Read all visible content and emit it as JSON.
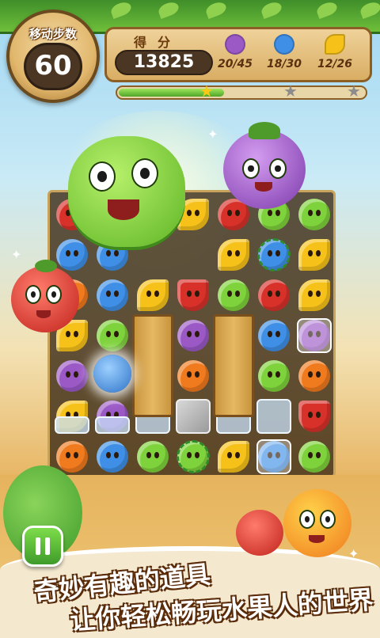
{
  "hud": {
    "moves_label": "移动步数",
    "moves_value": "60",
    "score_label": "得分",
    "score_value": "13825",
    "goals": [
      {
        "icon": "mangosteen-icon",
        "color": "#9b59c6",
        "text": "20/45"
      },
      {
        "icon": "blueberry-icon",
        "color": "#3f8fe6",
        "text": "18/30"
      },
      {
        "icon": "lemon-icon",
        "color": "#f6c21a",
        "text": "12/26"
      }
    ],
    "progress": {
      "fill_fraction": 0.43,
      "stars": [
        "star-earned-icon",
        "star-empty-icon",
        "star-empty-icon"
      ]
    }
  },
  "colors": {
    "apple": "#7ed23b",
    "orange": "#f07a1e",
    "blueberry": "#3f8fe6",
    "mangosteen": "#9b59c6",
    "red_apple": "#d8312a",
    "lemon": "#f6c21a"
  },
  "promo": {
    "line1": "奇妙有趣的道具",
    "line2": "让你轻松畅玩水果人的世界"
  },
  "controls": {
    "pause_icon": "pause-icon"
  }
}
